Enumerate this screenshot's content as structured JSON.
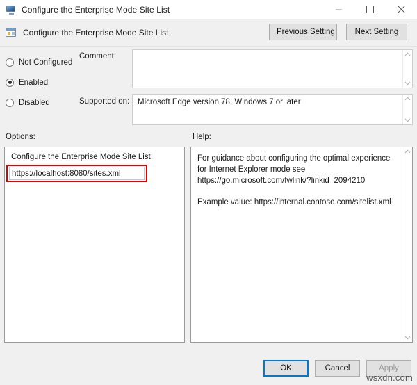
{
  "window": {
    "title": "Configure the Enterprise Mode Site List",
    "title_icon": "monitor-icon",
    "minimize_label": "—",
    "maximize_label": "□",
    "close_label": "×"
  },
  "header": {
    "icon": "group-policy-setting-icon",
    "title": "Configure the Enterprise Mode Site List",
    "previous_setting_label": "Previous Setting",
    "next_setting_label": "Next Setting"
  },
  "state": {
    "options": [
      {
        "label": "Not Configured",
        "checked": false
      },
      {
        "label": "Enabled",
        "checked": true
      },
      {
        "label": "Disabled",
        "checked": false
      }
    ]
  },
  "comment": {
    "label": "Comment:",
    "value": "",
    "scroll_up_icon": "chevron-up-icon",
    "scroll_down_icon": "chevron-down-icon"
  },
  "supported_on": {
    "label": "Supported on:",
    "value": "Microsoft Edge version 78, Windows 7 or later",
    "scroll_up_icon": "chevron-up-icon",
    "scroll_down_icon": "chevron-down-icon"
  },
  "options_panel": {
    "section_label": "Options:",
    "setting_label": "Configure the Enterprise Mode Site List",
    "input_value": "https://localhost:8080/sites.xml",
    "input_placeholder": "",
    "highlight_color": "#e00000"
  },
  "help_panel": {
    "section_label": "Help:",
    "paragraph_1": "For guidance about configuring the optimal experience for Internet Explorer mode see https://go.microsoft.com/fwlink/?linkid=2094210",
    "paragraph_2": "Example value: https://internal.contoso.com/sitelist.xml",
    "scroll_up_icon": "chevron-up-icon",
    "scroll_down_icon": "chevron-down-icon"
  },
  "footer": {
    "ok_label": "OK",
    "cancel_label": "Cancel",
    "apply_label": "Apply",
    "apply_disabled": true,
    "default_button_color": "#0078d7"
  },
  "watermark": {
    "text": "wsxdn.com"
  }
}
